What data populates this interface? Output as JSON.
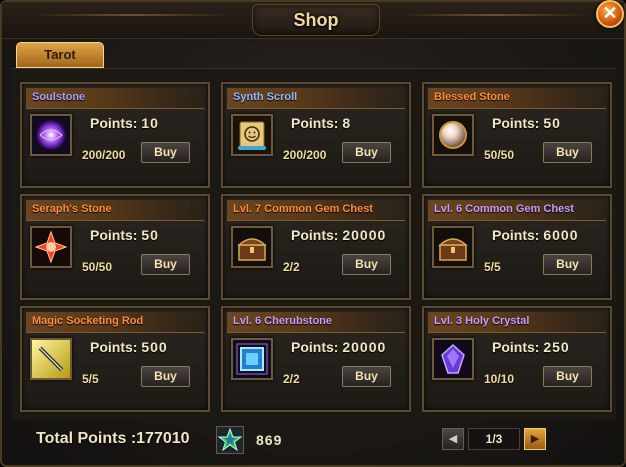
{
  "window": {
    "title": "Shop",
    "close_glyph": "✕"
  },
  "tabs": [
    {
      "label": "Tarot",
      "active": true
    }
  ],
  "items": [
    {
      "name": "Soulstone",
      "name_color": "#a79cff",
      "icon": "soulstone-icon",
      "points_label": "Points:",
      "points": "10",
      "quantity": "200/200",
      "buy_label": "Buy"
    },
    {
      "name": "Synth Scroll",
      "name_color": "#8fb8ff",
      "icon": "synth-scroll-icon",
      "points_label": "Points:",
      "points": "8",
      "quantity": "200/200",
      "buy_label": "Buy"
    },
    {
      "name": "Blessed Stone",
      "name_color": "#ff8a3c",
      "icon": "blessed-stone-icon",
      "points_label": "Points:",
      "points": "50",
      "quantity": "50/50",
      "buy_label": "Buy"
    },
    {
      "name": "Seraph's Stone",
      "name_color": "#ff8a3c",
      "icon": "seraphs-stone-icon",
      "points_label": "Points:",
      "points": "50",
      "quantity": "50/50",
      "buy_label": "Buy"
    },
    {
      "name": "Lvl. 7 Common Gem Chest",
      "name_color": "#ff8a3c",
      "icon": "gem-chest-icon",
      "points_label": "Points:",
      "points": "20000",
      "quantity": "2/2",
      "buy_label": "Buy"
    },
    {
      "name": "Lvl. 6 Common Gem Chest",
      "name_color": "#c69bff",
      "icon": "gem-chest-icon",
      "points_label": "Points:",
      "points": "6000",
      "quantity": "5/5",
      "buy_label": "Buy"
    },
    {
      "name": "Magic Socketing Rod",
      "name_color": "#ff8a3c",
      "icon": "socketing-rod-icon",
      "points_label": "Points:",
      "points": "500",
      "quantity": "5/5",
      "buy_label": "Buy"
    },
    {
      "name": "Lvl. 6 Cherubstone",
      "name_color": "#c69bff",
      "icon": "cherubstone-icon",
      "points_label": "Points:",
      "points": "20000",
      "quantity": "2/2",
      "buy_label": "Buy"
    },
    {
      "name": "Lvl. 3 Holy Crystal",
      "name_color": "#c69bff",
      "icon": "holy-crystal-icon",
      "points_label": "Points:",
      "points": "250",
      "quantity": "10/10",
      "buy_label": "Buy"
    }
  ],
  "footer": {
    "total_points_label": "Total Points :",
    "total_points_value": "177010",
    "star_icon": "green-star-icon",
    "star_count": "869",
    "page": "1/3"
  }
}
